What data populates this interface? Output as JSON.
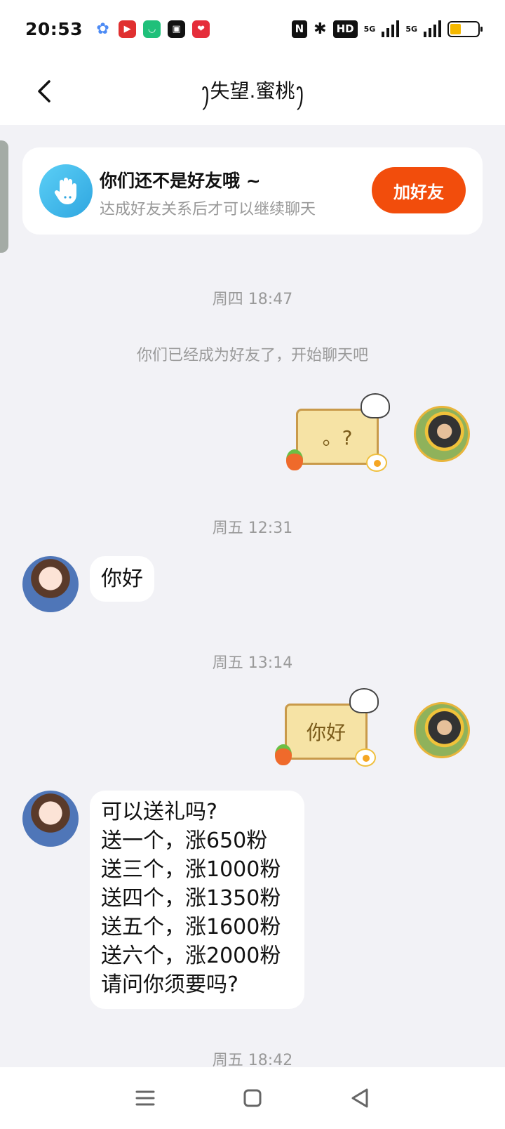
{
  "status_bar": {
    "time": "20:53",
    "hd": "HD",
    "net1": "5G",
    "net2": "5G",
    "battery_level": 0.4,
    "app_icons": [
      "blue-flower-app-icon",
      "video-app-icon",
      "green-tv-app-icon",
      "camera-app-icon",
      "red-heart-app-icon"
    ]
  },
  "header": {
    "title": "ꫂ失望.蜜桃ꫂ"
  },
  "banner": {
    "title": "你们还不是好友哦 ~",
    "subtitle": "达成好友关系后才可以继续聊天",
    "button_label": "加好友"
  },
  "messages": {
    "ts1": "周四 18:47",
    "system": "你们已经成为好友了，开始聊天吧",
    "sticker1_text": "。?",
    "ts2": "周五 12:31",
    "msg1": "你好",
    "ts3": "周五 13:14",
    "sticker2_text": "你好",
    "msg2": "可以送礼吗?\n送一个，涨650粉\n送三个，涨1000粉\n送四个，涨1350粉\n送五个，涨1600粉\n送六个，涨2000粉\n  请问你须要吗?",
    "ts4": "周五 18:42"
  },
  "colors": {
    "accent": "#f24d0c",
    "background": "#f2f2f6"
  }
}
